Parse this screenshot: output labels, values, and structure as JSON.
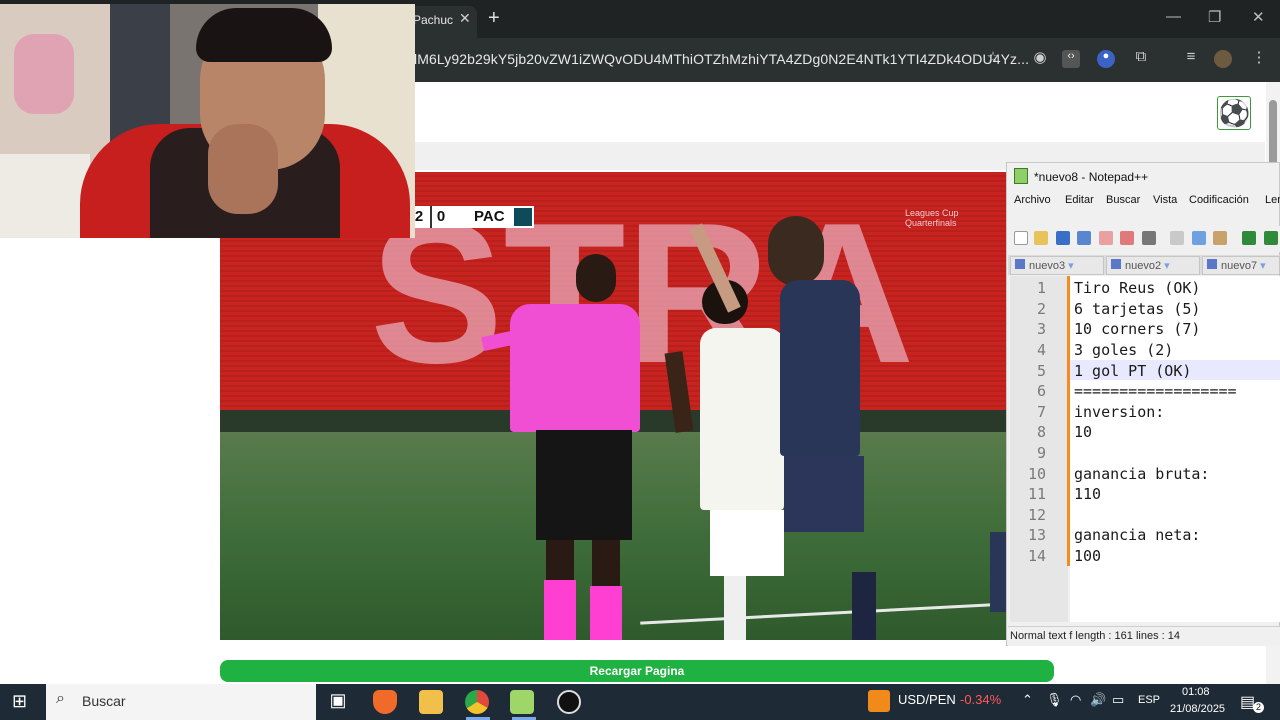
{
  "browser": {
    "tab_title": "Pachuc",
    "url": "lM6Ly92b29kY5jb20vZW1iZWQvODU4MThiOTZhMzhiYTA4ZDg0N2E4NTk1YTI4ZDk4ODU4Yz...",
    "new_tab_symbol": "+"
  },
  "page": {
    "reload_button": "Recargar Pagina",
    "scoreboard": {
      "home_score": "2",
      "away_score": "0",
      "away_team": "PAC"
    },
    "ad_text": "Leagues Cup Quarterfinals"
  },
  "notepad": {
    "title": "*nuevo8 - Notepad++",
    "menu": [
      "Archivo",
      "Editar",
      "Buscar",
      "Vista",
      "Codificación",
      "Len"
    ],
    "tabs": [
      "nuevo3",
      "nuevo2",
      "nuevo7"
    ],
    "line_numbers": [
      "1",
      "2",
      "3",
      "4",
      "5",
      "6",
      "7",
      "8",
      "9",
      "10",
      "11",
      "12",
      "13",
      "14"
    ],
    "lines": [
      "Tiro Reus (OK)",
      "6 tarjetas (5)",
      "10 corners (7)",
      "3 goles (2)",
      "1 gol PT (OK)",
      "==================",
      "inversion:",
      "10",
      "",
      "ganancia bruta:",
      "110",
      "",
      "ganancia neta:",
      "100"
    ],
    "status": "Normal text f  length : 161    lines : 14"
  },
  "taskbar": {
    "search_label": "Buscar",
    "currency_pair": "USD/PEN",
    "currency_change": "-0.34%",
    "language": "ESP",
    "time": "01:08",
    "date": "21/08/2025",
    "notification_count": "2"
  },
  "colors": {
    "reload_green": "#1fb141",
    "notepad_margin": "#f58b1f",
    "currency_negative": "#ff5a5a"
  }
}
